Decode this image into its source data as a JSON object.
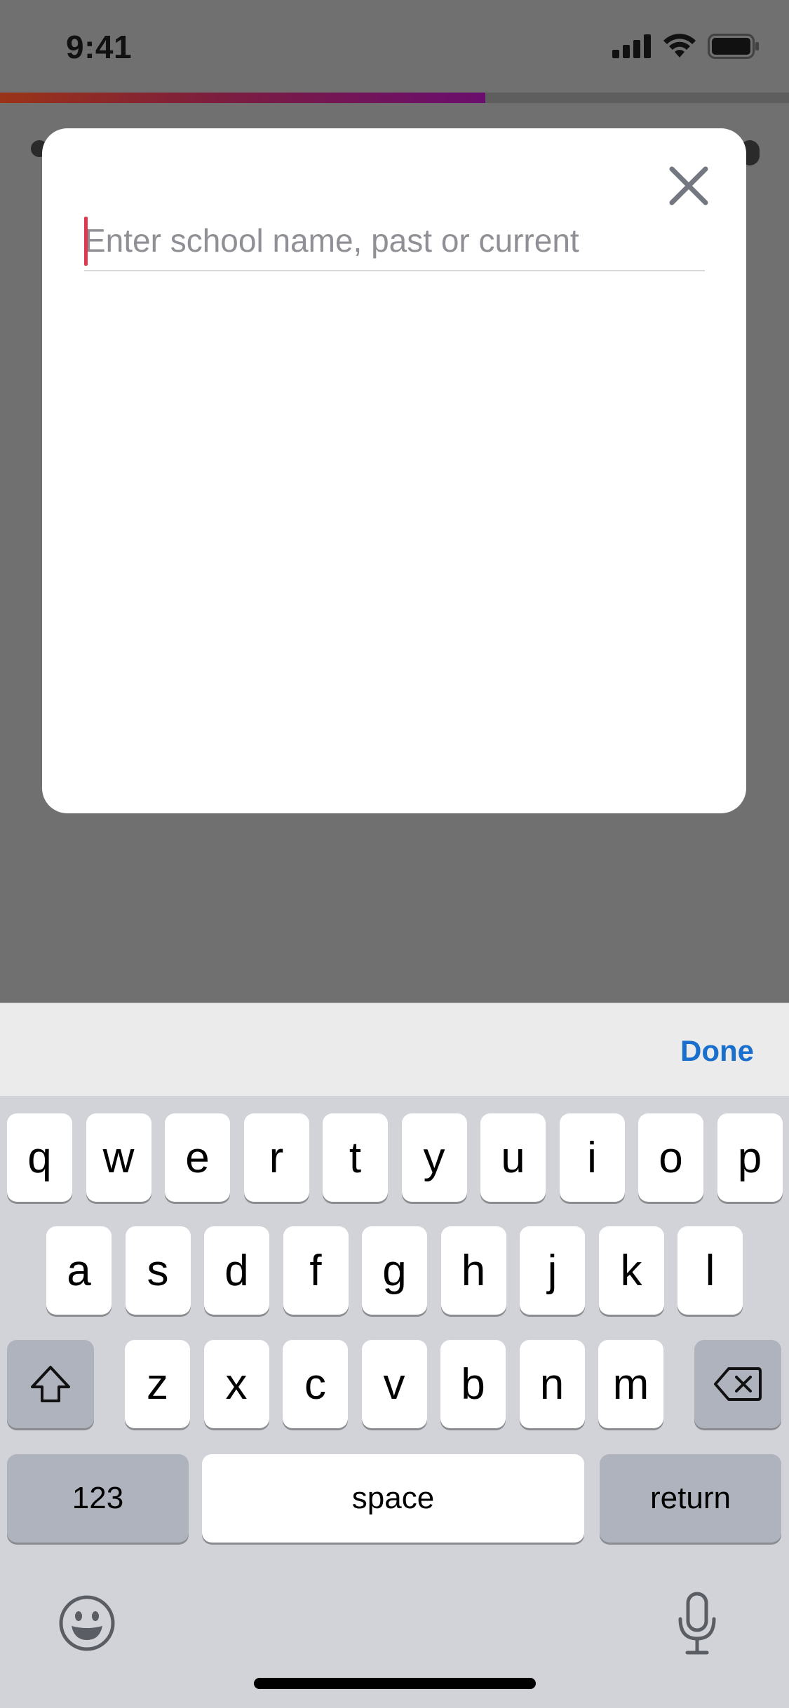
{
  "status_bar": {
    "time": "9:41",
    "icons": [
      "signal-icon",
      "wifi-icon",
      "battery-icon"
    ]
  },
  "progress": {
    "fraction": 0.615,
    "colors": {
      "start": "#9a3417",
      "mid": "#7c1d3f",
      "end": "#6a0d6e"
    }
  },
  "modal": {
    "close_icon": "close-icon",
    "search": {
      "placeholder": "Enter school name, past or current",
      "value": ""
    }
  },
  "keyboard": {
    "done_label": "Done",
    "row1": [
      "q",
      "w",
      "e",
      "r",
      "t",
      "y",
      "u",
      "i",
      "o",
      "p"
    ],
    "row2": [
      "a",
      "s",
      "d",
      "f",
      "g",
      "h",
      "j",
      "k",
      "l"
    ],
    "row3": [
      "z",
      "x",
      "c",
      "v",
      "b",
      "n",
      "m"
    ],
    "numbers_label": "123",
    "space_label": "space",
    "return_label": "return",
    "shift_icon": "shift-icon",
    "delete_icon": "delete-icon",
    "emoji_icon": "emoji-icon",
    "mic_icon": "microphone-icon"
  },
  "colors": {
    "overlay": "#707070",
    "caret": "#e0364f",
    "done": "#1a6fcc",
    "keyboard_bg": "#d1d3d9"
  }
}
